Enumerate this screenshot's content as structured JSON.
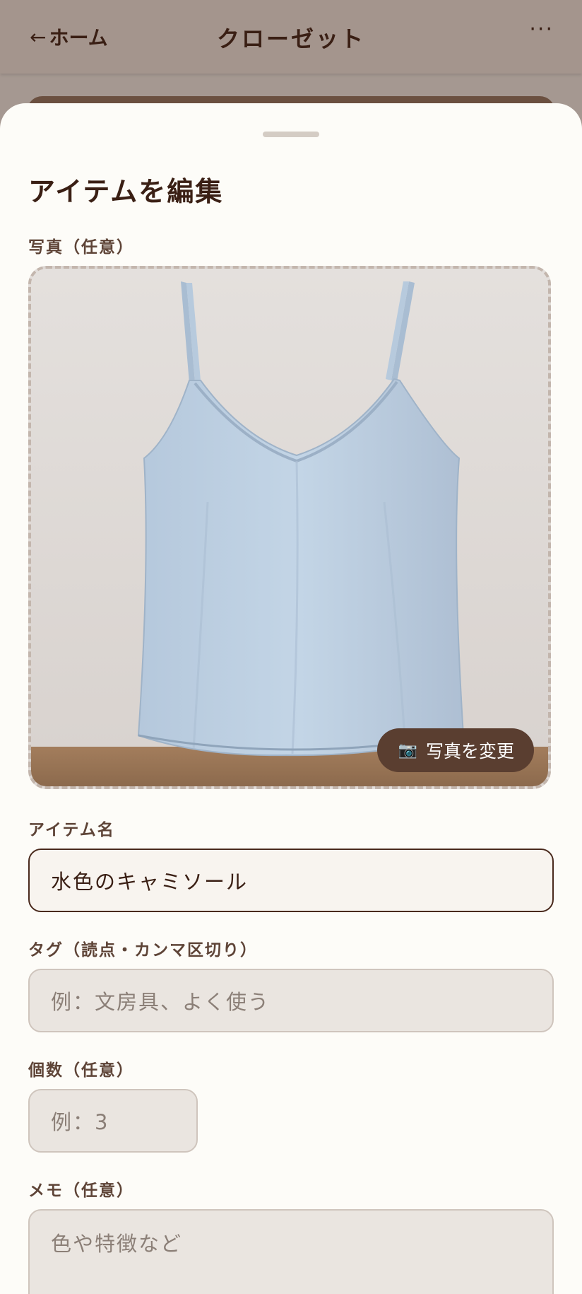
{
  "header": {
    "back_arrow": "←",
    "back_label": "ホーム",
    "title": "クローゼット",
    "more_label": "···"
  },
  "sheet": {
    "title": "アイテムを編集",
    "photo": {
      "label": "写真（任意）",
      "change_button_icon": "📷",
      "change_button_label": "写真を変更"
    },
    "name": {
      "label": "アイテム名",
      "value": "水色のキャミソール"
    },
    "tags": {
      "label": "タグ（読点・カンマ区切り）",
      "placeholder": "例：文房具、よく使う"
    },
    "count": {
      "label": "個数（任意）",
      "placeholder": "例：3"
    },
    "memo": {
      "label": "メモ（任意）",
      "placeholder": "色や特徴など"
    }
  },
  "colors": {
    "accent": "#3a1f14",
    "sheet_background": "#fdfcf8",
    "button_dark": "#5a3e30"
  }
}
